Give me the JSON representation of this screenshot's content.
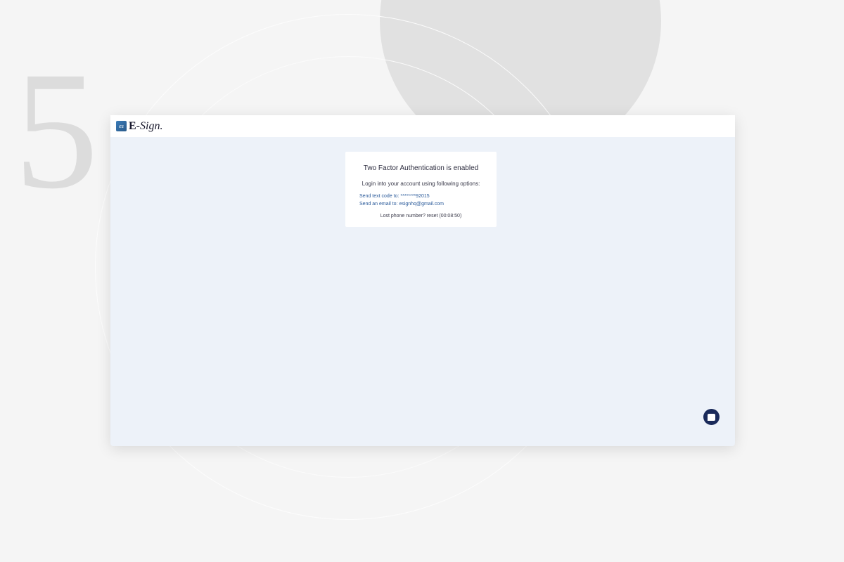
{
  "background": {
    "numeral": "5"
  },
  "logo": {
    "brand_name": "E-Sign.",
    "icon_text": "es"
  },
  "auth_card": {
    "title": "Two Factor Authentication is enabled",
    "instruction": "Login into your account using following options:",
    "sms_option": {
      "label": "Send text code to:",
      "value": "********92015"
    },
    "email_option": {
      "label": "Send an email to:",
      "value": "esignhq@gmail.com"
    },
    "footer": {
      "text": "Lost phone number? reset",
      "countdown": "(00:08:50)"
    }
  }
}
